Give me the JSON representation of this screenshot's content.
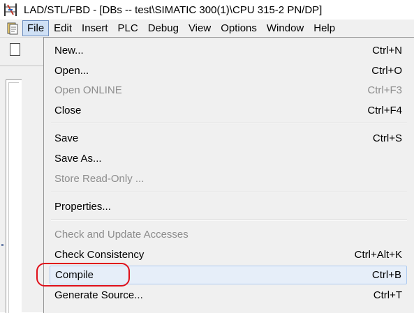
{
  "window": {
    "title": "LAD/STL/FBD  - [DBs -- test\\SIMATIC 300(1)\\CPU 315-2 PN/DP]",
    "app_icon": "ladder-app-icon",
    "system_icon": "document-system-icon"
  },
  "menubar": {
    "items": [
      {
        "label": "File",
        "active": true
      },
      {
        "label": "Edit"
      },
      {
        "label": "Insert"
      },
      {
        "label": "PLC"
      },
      {
        "label": "Debug"
      },
      {
        "label": "View"
      },
      {
        "label": "Options"
      },
      {
        "label": "Window"
      },
      {
        "label": "Help"
      }
    ]
  },
  "file_menu": {
    "items": [
      {
        "label": "New...",
        "accel": "Ctrl+N",
        "enabled": true
      },
      {
        "label": "Open...",
        "accel": "Ctrl+O",
        "enabled": true
      },
      {
        "label": "Open ONLINE",
        "accel": "Ctrl+F3",
        "enabled": false
      },
      {
        "label": "Close",
        "accel": "Ctrl+F4",
        "enabled": true
      },
      {
        "label": "Save",
        "accel": "Ctrl+S",
        "enabled": true
      },
      {
        "label": "Save As...",
        "accel": "",
        "enabled": true
      },
      {
        "label": "Store Read-Only ...",
        "accel": "",
        "enabled": false
      },
      {
        "label": "Properties...",
        "accel": "",
        "enabled": true
      },
      {
        "label": "Check and Update Accesses",
        "accel": "",
        "enabled": false
      },
      {
        "label": "Check Consistency",
        "accel": "Ctrl+Alt+K",
        "enabled": true
      },
      {
        "label": "Compile",
        "accel": "Ctrl+B",
        "enabled": true,
        "highlighted": true
      },
      {
        "label": "Generate Source...",
        "accel": "Ctrl+T",
        "enabled": true
      }
    ]
  },
  "annotation": {
    "color": "#e0101a",
    "target": "Compile"
  }
}
